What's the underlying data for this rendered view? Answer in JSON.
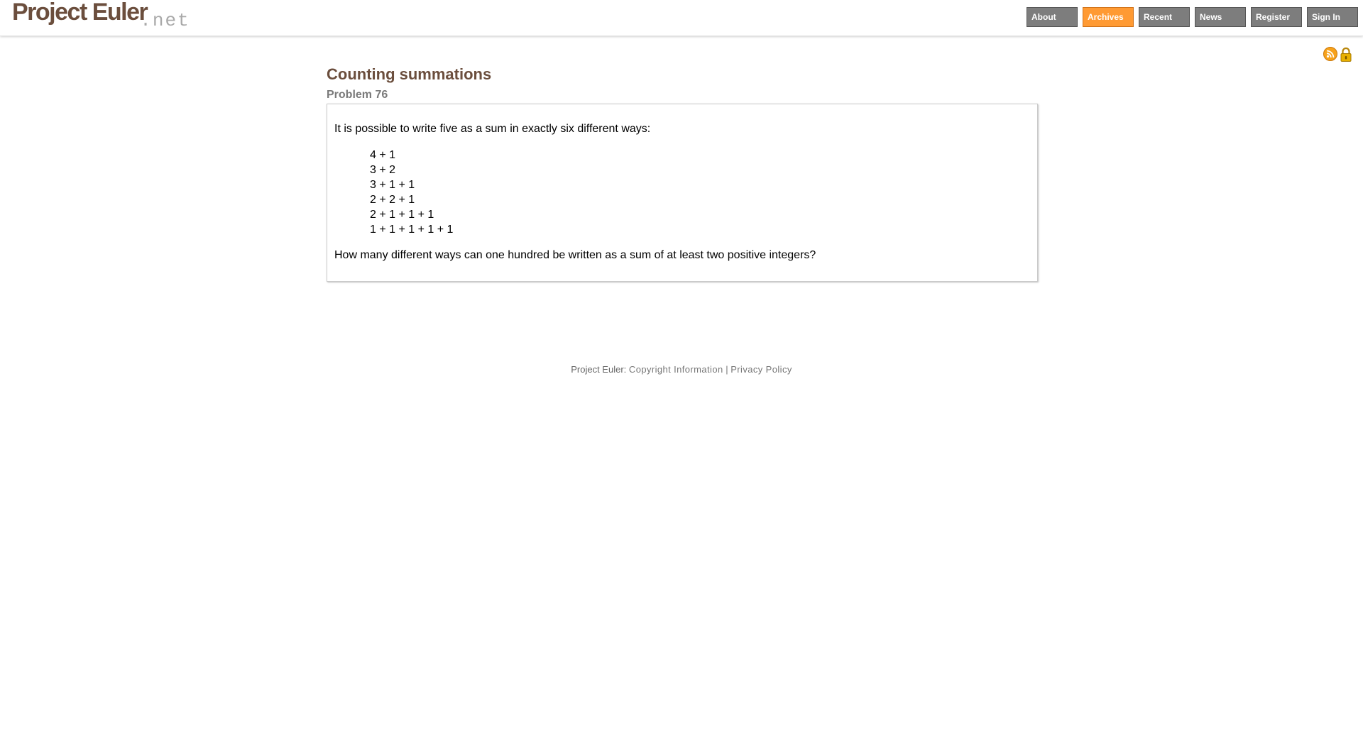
{
  "header": {
    "logo_main": "Project Euler",
    "logo_suffix": ".net",
    "nav": [
      {
        "label": "About",
        "active": false
      },
      {
        "label": "Archives",
        "active": true
      },
      {
        "label": "Recent",
        "active": false
      },
      {
        "label": "News",
        "active": false
      },
      {
        "label": "Register",
        "active": false
      },
      {
        "label": "Sign In",
        "active": false
      }
    ],
    "icons": [
      "rss-feed-icon",
      "lock-icon"
    ]
  },
  "problem": {
    "title": "Counting summations",
    "number": "Problem 76",
    "intro": "It is possible to write five as a sum in exactly six different ways:",
    "sums": [
      "4 + 1",
      "3 + 2",
      "3 + 1 + 1",
      "2 + 2 + 1",
      "2 + 1 + 1 + 1",
      "1 + 1 + 1 + 1 + 1"
    ],
    "question": "How many different ways can one hundred be written as a sum of at least two positive integers?"
  },
  "footer": {
    "label": "Project Euler:",
    "copyright_link": "Copyright Information",
    "separator": "|",
    "privacy_link": "Privacy Policy"
  },
  "colors": {
    "brand_brown": "#6b4e3d",
    "nav_gray": "#7d7d7d",
    "nav_active_orange": "#ff9a33",
    "rss_orange": "#f7a21b",
    "lock_gold": "#e8b000"
  }
}
